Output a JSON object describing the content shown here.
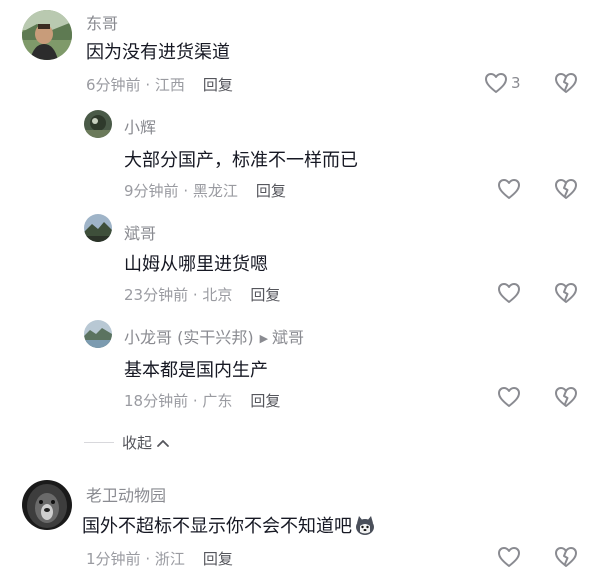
{
  "comments": [
    {
      "username": "东哥",
      "text": "因为没有进货渠道",
      "time": "6分钟前",
      "location": "江西",
      "reply_label": "回复",
      "like_count": "3",
      "replies": [
        {
          "username": "小辉",
          "text": "大部分国产，标准不一样而已",
          "time": "9分钟前",
          "location": "黑龙江",
          "reply_label": "回复"
        },
        {
          "username": "斌哥",
          "text": "山姆从哪里进货嗯",
          "time": "23分钟前",
          "location": "北京",
          "reply_label": "回复"
        },
        {
          "username": "小龙哥 (实干兴邦)",
          "reply_to": "斌哥",
          "text": "基本都是国内生产",
          "time": "18分钟前",
          "location": "广东",
          "reply_label": "回复"
        }
      ],
      "collapse_label": "收起"
    },
    {
      "username": "老卫动物园",
      "text": "国外不超标不显示你不会不知道吧",
      "time": "1分钟前",
      "location": "浙江",
      "reply_label": "回复"
    }
  ],
  "separator": " · ",
  "icons": {
    "like": "heart-outline-icon",
    "dislike": "broken-heart-icon",
    "collapse": "chevron-up-icon",
    "emoji": "husky-dog-emoji-icon"
  },
  "colors": {
    "text_primary": "#161823",
    "text_secondary": "#8a8b91",
    "icon": "#8a8b91"
  }
}
